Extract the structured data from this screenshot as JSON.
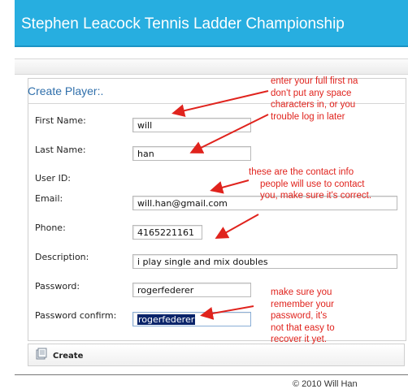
{
  "header": {
    "title": "Stephen Leacock Tennis Ladder Championship"
  },
  "form": {
    "title": "Create Player:.",
    "fields": {
      "first_name": {
        "label": "First Name:",
        "value": "will"
      },
      "last_name": {
        "label": "Last Name:",
        "value": "han"
      },
      "user_id": {
        "label": "User ID:"
      },
      "email": {
        "label": "Email:",
        "value": "will.han@gmail.com"
      },
      "phone": {
        "label": "Phone:",
        "value": "4165221161"
      },
      "description": {
        "label": "Description:",
        "value": "i play single and mix doubles"
      },
      "password": {
        "label": "Password:",
        "value": "rogerfederer"
      },
      "password_confirm": {
        "label": "Password confirm:",
        "value": "rogerfederer"
      }
    },
    "create_label": "Create"
  },
  "footer": {
    "copyright": "© 2010 Will Han"
  },
  "annotations": {
    "name_note": [
      "enter your full first na",
      "don't put any space",
      "characters in, or you",
      "trouble log in later"
    ],
    "contact_note": [
      "these  are the contact info",
      "people will use to contact",
      "you, make sure it's correct."
    ],
    "password_note": [
      "make sure you",
      "remember your",
      "password, it's",
      "not that easy to",
      "recover it yet."
    ]
  },
  "colors": {
    "header_bg": "#27aee0",
    "annotation": "#e0231d",
    "title_text": "#2f6fab"
  }
}
